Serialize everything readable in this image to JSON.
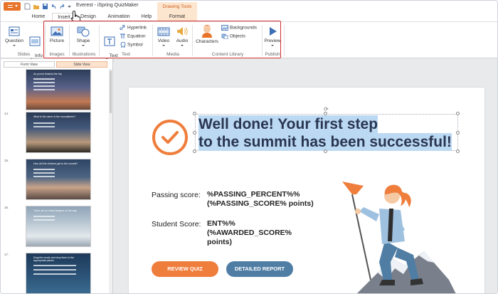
{
  "window": {
    "title": "Everest - iSpring QuizMaker"
  },
  "colors": {
    "accent": "#e8742a",
    "highlight": "#d32f2f",
    "selection": "#bcd9f4",
    "review_button": "#ef7d3b",
    "report_button": "#4f7da3"
  },
  "tabs": [
    {
      "label": "Home"
    },
    {
      "label": "Insert"
    },
    {
      "label": "Design"
    },
    {
      "label": "Animation"
    },
    {
      "label": "Help"
    }
  ],
  "contextual_tab": {
    "group": "Drawing Tools",
    "label": "Format"
  },
  "ribbon": {
    "question": "Question",
    "info_slide": "Info\nSlide",
    "picture": "Picture",
    "shape": "Shape",
    "text_box": "Text\nBox",
    "hyperlink": "Hyperlink",
    "equation": "Equation",
    "symbol": "Symbol",
    "video": "Video",
    "audio": "Audio",
    "characters": "Characters",
    "backgrounds": "Backgrounds",
    "objects": "Objects",
    "preview": "Preview",
    "groups": {
      "slides": "Slides",
      "images": "Images",
      "illustrations": "Illustrations",
      "text": "Text",
      "media": "Media",
      "content_library": "Content Library",
      "publish": "Publish"
    }
  },
  "left_panel": {
    "form_view": "Form View",
    "slide_view": "Slide View",
    "slides": [
      {
        "number": "",
        "text": "As you've finished the trip"
      },
      {
        "number": "14.",
        "text": "What is the name of the mountaineer?"
      },
      {
        "number": "15.",
        "text": "How did the climbers get to the summit?"
      },
      {
        "number": "16.",
        "text": "There are so many dangers on the way"
      },
      {
        "number": "17.",
        "text": "Drag the words and drop them to the appropriate places"
      }
    ]
  },
  "slide": {
    "title_line1": "Well done! Your first step",
    "title_line2": "to the summit has been successful!",
    "passing_label": "Passing score:",
    "passing_value1": "%PASSING_PERCENT%%",
    "passing_value2": "(%PASSING_SCORE% points)",
    "student_label": "Student Score:",
    "student_value1": "ENT%%",
    "student_value2": "(%AWARDED_SCORE%",
    "student_value3": "points)",
    "review_button": "REVIEW QUIZ",
    "report_button": "DETAILED REPORT"
  }
}
